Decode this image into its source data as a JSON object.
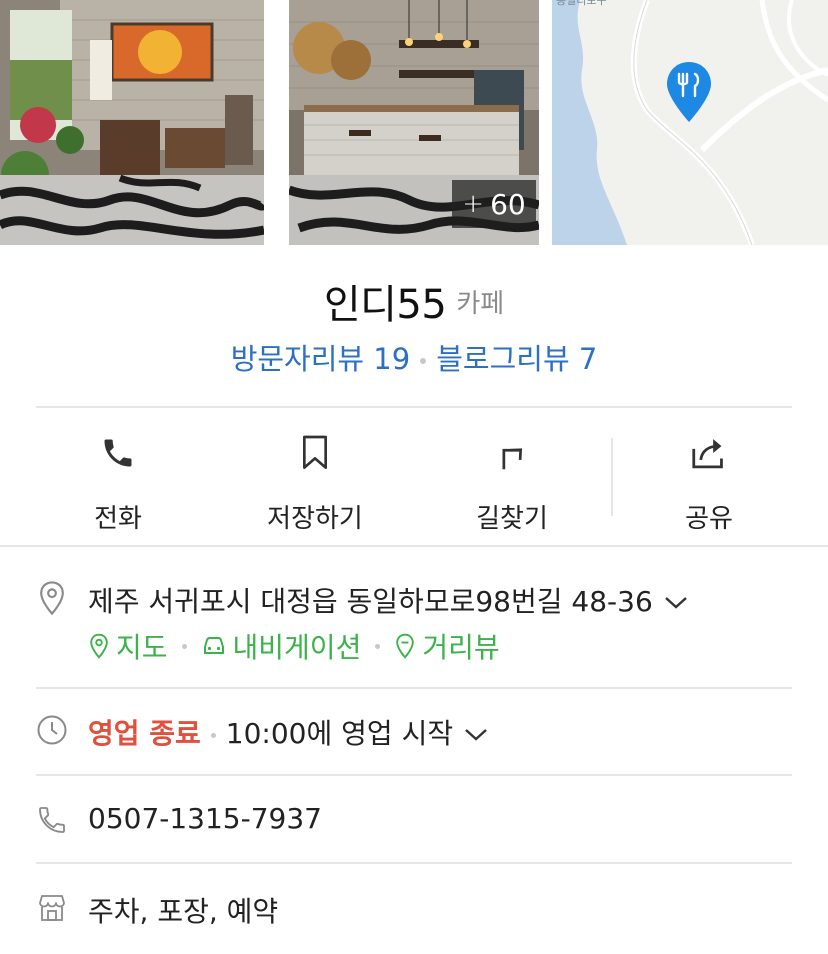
{
  "photos": {
    "more_count": "60",
    "map_pin_icon": "fork-knife-pin-icon",
    "map_label": "동일리포구"
  },
  "place": {
    "name": "인디55",
    "category": "카페"
  },
  "reviews": {
    "visitor": "방문자리뷰 19",
    "blog": "블로그리뷰 7"
  },
  "actions": [
    {
      "label": "전화",
      "icon": "phone-icon"
    },
    {
      "label": "저장하기",
      "icon": "bookmark-icon"
    },
    {
      "label": "길찾기",
      "icon": "directions-icon"
    },
    {
      "label": "공유",
      "icon": "share-icon"
    }
  ],
  "address": {
    "text": "제주 서귀포시 대정읍 동일하모로98번길 48-36",
    "links": {
      "map": "지도",
      "navigation": "내비게이션",
      "streetview": "거리뷰"
    }
  },
  "hours": {
    "status": "영업 종료",
    "next": "10:00에 영업 시작"
  },
  "phone": "0507-1315-7937",
  "amenities": "주차, 포장, 예약",
  "colors": {
    "link_blue": "#2b6fc6",
    "green": "#3cb34a",
    "closed_red": "#e0503d",
    "map_pin_blue": "#1e88e5"
  }
}
